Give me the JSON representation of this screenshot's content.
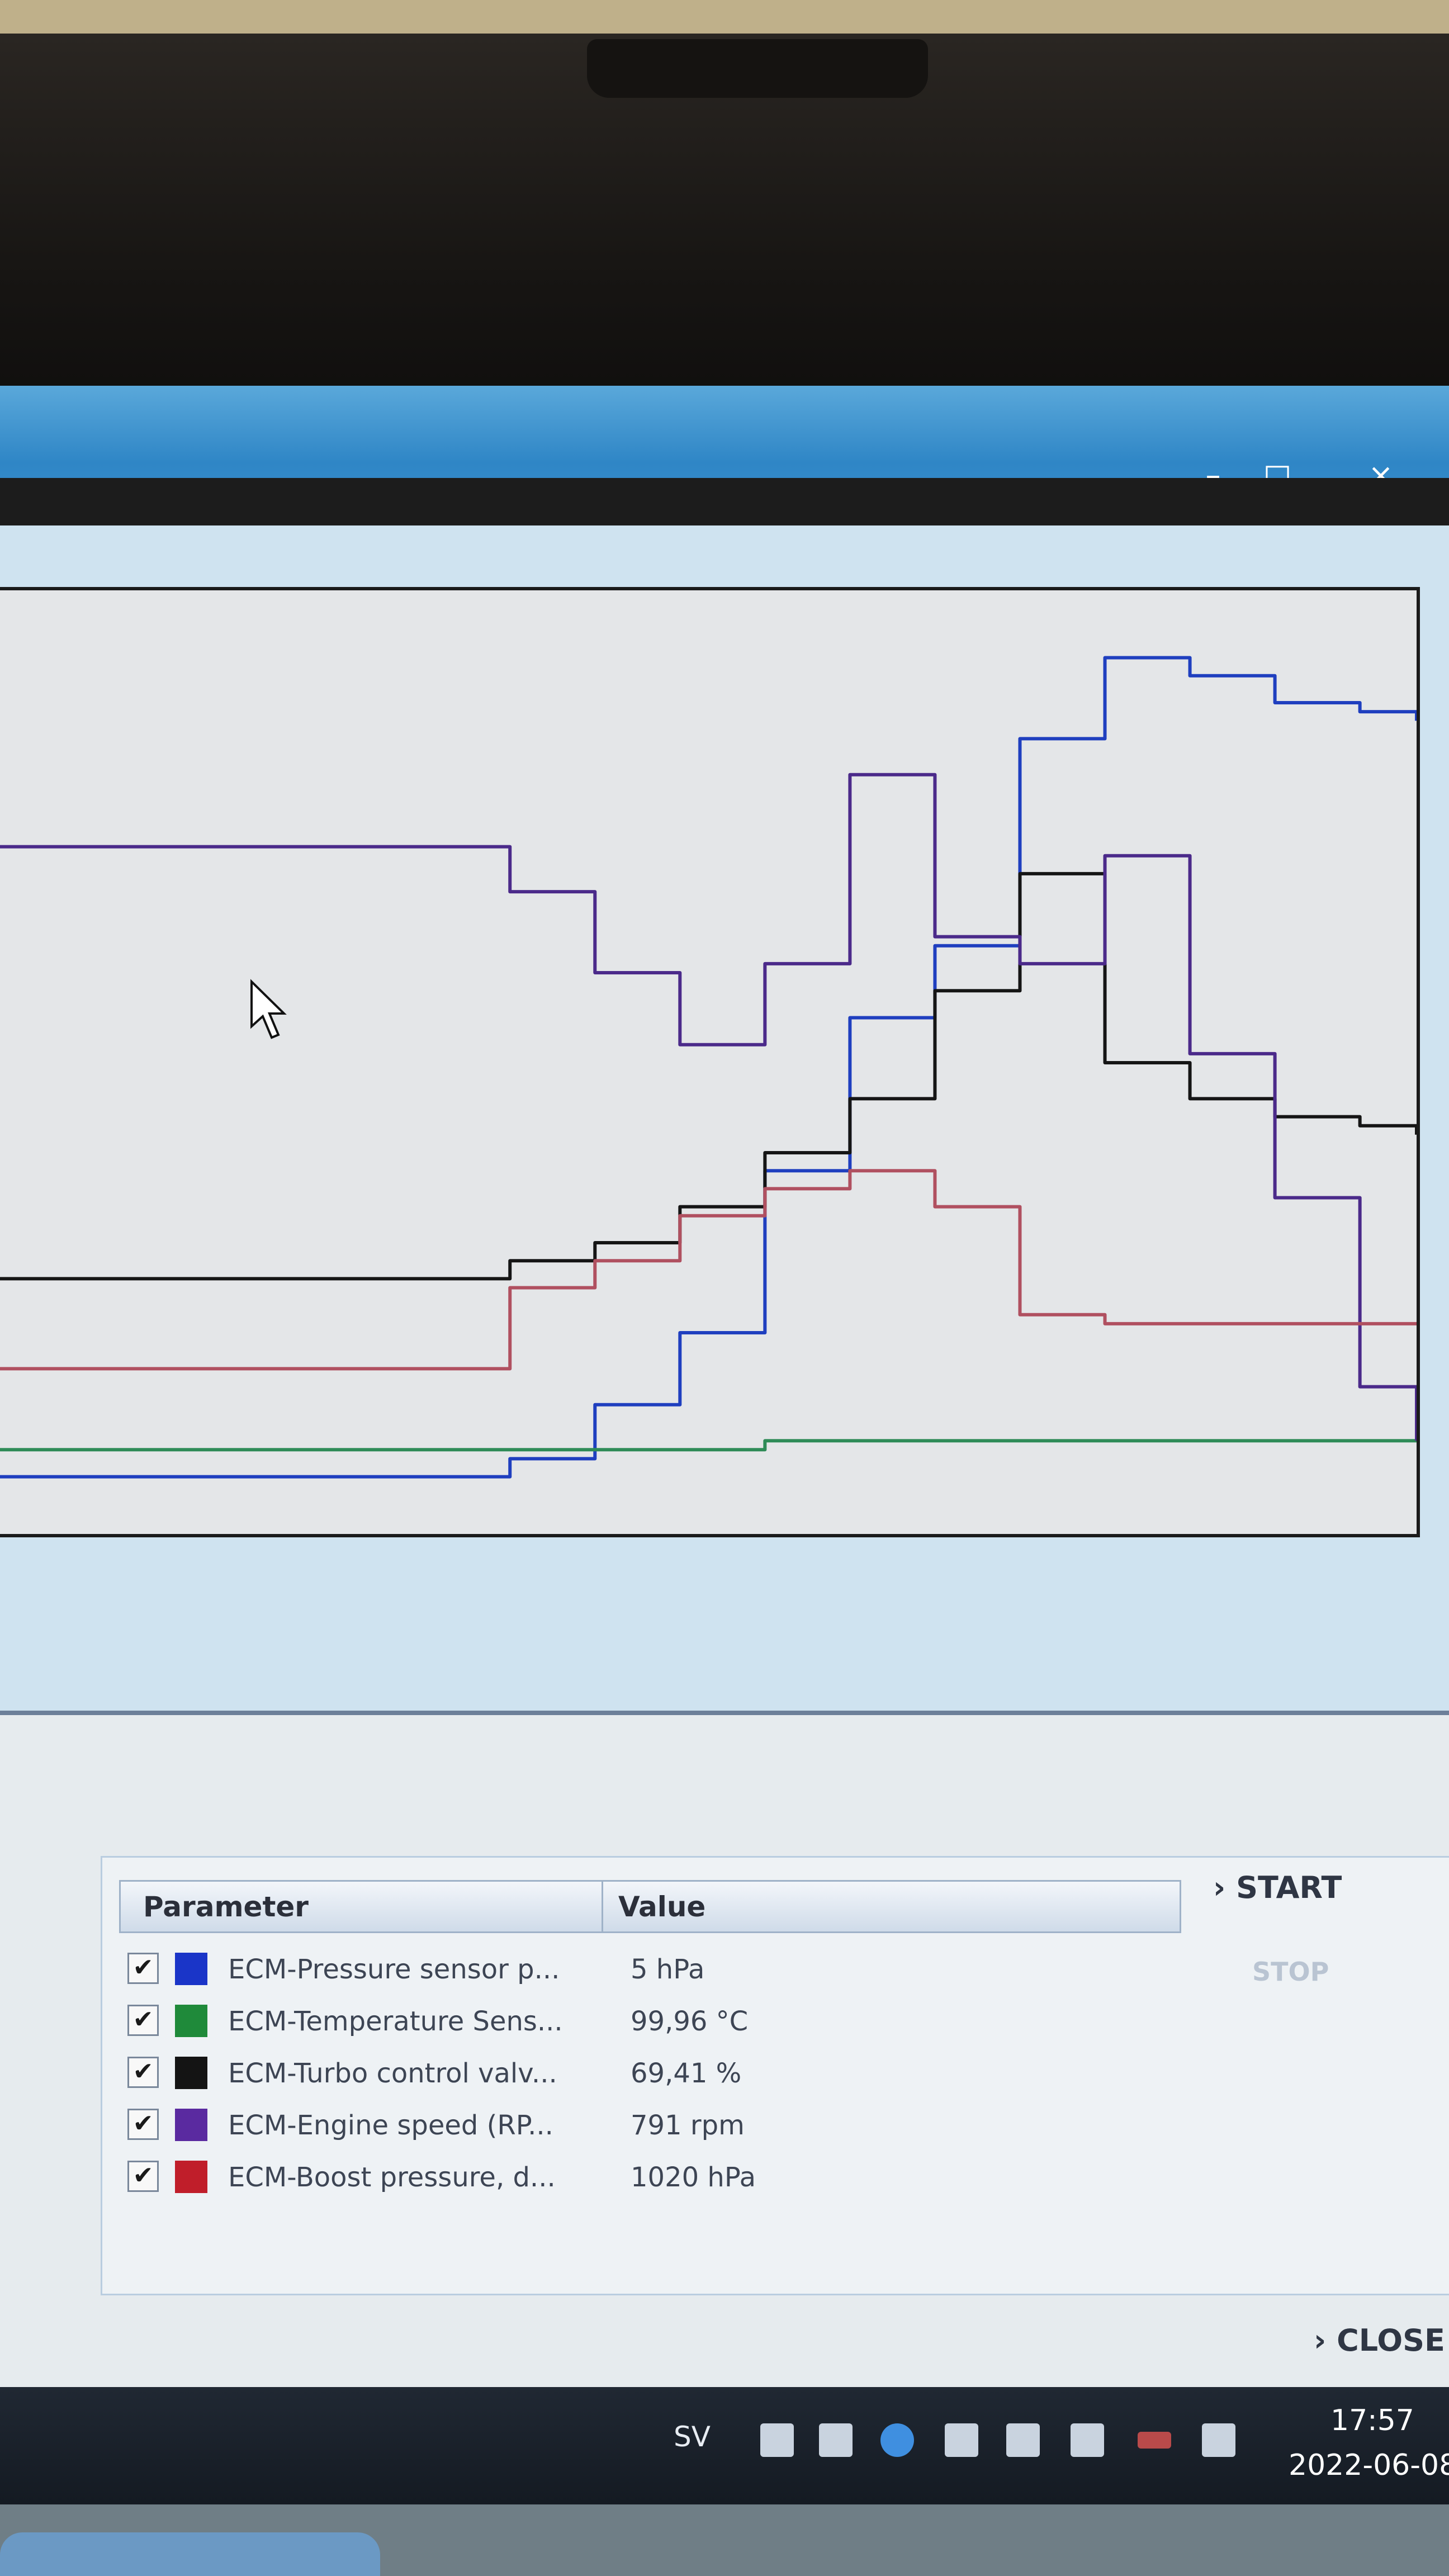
{
  "window": {
    "minimize": "–",
    "maximize": "□",
    "close": "×"
  },
  "chart_data": {
    "type": "line",
    "title": "",
    "xlabel": "",
    "ylabel": "",
    "x": [
      0,
      6,
      12,
      18,
      24,
      30,
      36,
      42,
      48,
      54,
      60,
      66,
      72,
      78,
      84,
      90,
      96,
      100
    ],
    "xlim": [
      0,
      100
    ],
    "ylim": [
      0,
      100
    ],
    "grid": false,
    "series": [
      {
        "name": "ECM-Pressure sensor p...",
        "color": "#1f3fbf",
        "values": [
          4,
          4,
          4,
          4,
          4,
          4,
          6,
          12,
          20,
          38,
          55,
          63,
          86,
          95,
          93,
          90,
          89,
          88
        ]
      },
      {
        "name": "ECM-Temperature Sens...",
        "color": "#2e8b57",
        "values": [
          7,
          7,
          7,
          7,
          7,
          7,
          7,
          7,
          7,
          8,
          8,
          8,
          8,
          8,
          8,
          8,
          8,
          8
        ]
      },
      {
        "name": "ECM-Turbo control valv...",
        "color": "#151515",
        "values": [
          26,
          26,
          26,
          26,
          26,
          26,
          28,
          30,
          34,
          40,
          46,
          58,
          71,
          50,
          46,
          44,
          43,
          42
        ]
      },
      {
        "name": "ECM-Engine speed (RP...",
        "color": "#4b2a8a",
        "values": [
          74,
          74,
          74,
          74,
          74,
          74,
          69,
          60,
          52,
          61,
          82,
          64,
          61,
          73,
          51,
          35,
          14,
          8
        ]
      },
      {
        "name": "ECM-Boost pressure, d...",
        "color": "#b05060",
        "values": [
          16,
          16,
          16,
          16,
          16,
          16,
          25,
          28,
          33,
          36,
          38,
          34,
          22,
          21,
          21,
          21,
          21,
          21
        ]
      }
    ]
  },
  "table": {
    "header_parameter": "Parameter",
    "header_value": "Value",
    "rows": [
      {
        "checked": "✔",
        "name": "ECM-Pressure sensor p...",
        "value": "5 hPa",
        "color": "#1a35c8"
      },
      {
        "checked": "✔",
        "name": "ECM-Temperature Sens...",
        "value": "99,96 °C",
        "color": "#1f8a3a"
      },
      {
        "checked": "✔",
        "name": "ECM-Turbo control valv...",
        "value": "69,41 %",
        "color": "#141414"
      },
      {
        "checked": "✔",
        "name": "ECM-Engine speed (RP...",
        "value": "791 rpm",
        "color": "#5a2aa0"
      },
      {
        "checked": "✔",
        "name": "ECM-Boost pressure, d...",
        "value": "1020 hPa",
        "color": "#c01e2a"
      }
    ]
  },
  "buttons": {
    "start": "START",
    "start_arrow": "›",
    "stop": "STOP",
    "close": "CLOSE",
    "close_arrow": "›"
  },
  "taskbar": {
    "language": "SV",
    "time": "17:57",
    "date": "2022-06-08"
  }
}
